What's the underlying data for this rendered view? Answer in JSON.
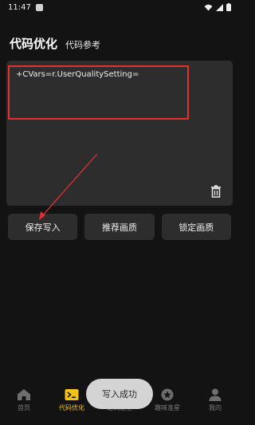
{
  "status_bar": {
    "time": "11:47"
  },
  "header": {
    "title": "代码优化",
    "ref_link": "代码参考"
  },
  "editor": {
    "text": "+CVars=r.UserQualitySetting="
  },
  "buttons": {
    "save": "保存写入",
    "recommend": "推荐画质",
    "lock": "锁定画质"
  },
  "toast": {
    "message": "写入成功"
  },
  "tabs": [
    {
      "label": "首页",
      "icon": "home-icon",
      "active": false
    },
    {
      "label": "代码优化",
      "icon": "terminal-icon",
      "active": true
    },
    {
      "label": "定制准星",
      "icon": "crosshair-icon",
      "active": false
    },
    {
      "label": "趣味准星",
      "icon": "star-icon",
      "active": false
    },
    {
      "label": "我的",
      "icon": "person-icon",
      "active": false
    }
  ],
  "colors": {
    "background": "#131313",
    "panel": "#2d2d2d",
    "accent": "#f2c21b",
    "annotation": "#e03030"
  }
}
